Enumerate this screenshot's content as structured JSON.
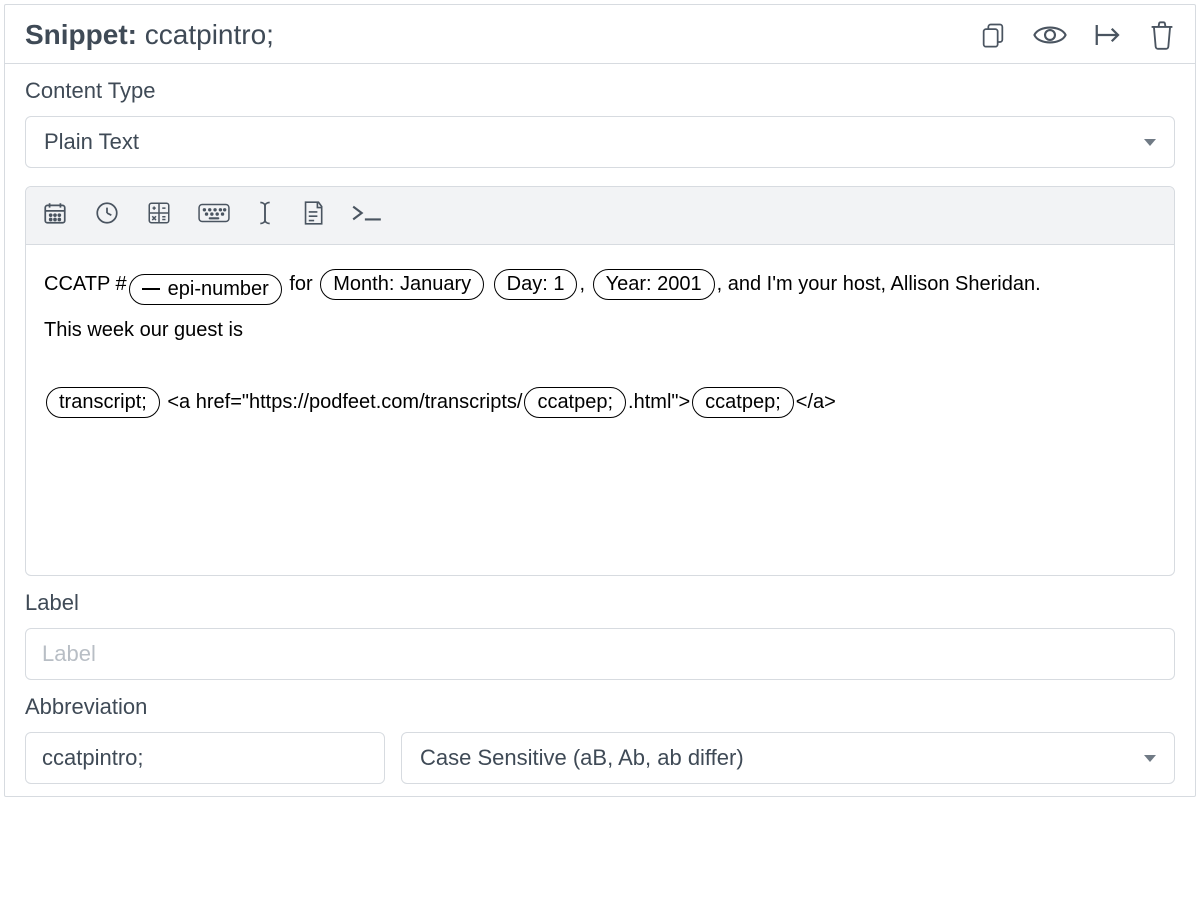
{
  "header": {
    "prefix": "Snippet:",
    "name": "ccatpintro;"
  },
  "contentType": {
    "label": "Content Type",
    "value": "Plain Text"
  },
  "editor": {
    "text1_prefix": "CCATP #",
    "token_epi": "epi-number",
    "text_for": " for ",
    "token_month": "Month: January",
    "text_gap1": " ",
    "token_day": "Day: 1",
    "text_comma1": ", ",
    "token_year": "Year: 2001",
    "text_tail1": ", and I'm your host, Allison Sheridan.",
    "line2": "This week our guest is",
    "token_transcript": "transcript;",
    "text_href1": " <a href=\"https://podfeet.com/transcripts/",
    "token_ccatpep1": "ccatpep;",
    "text_href2": ".html\">",
    "token_ccatpep2": "ccatpep;",
    "text_href_close": "</a>"
  },
  "label": {
    "label": "Label",
    "placeholder": "Label"
  },
  "abbreviation": {
    "label": "Abbreviation",
    "value": "ccatpintro;",
    "case": "Case Sensitive (aB, Ab, ab differ)"
  }
}
